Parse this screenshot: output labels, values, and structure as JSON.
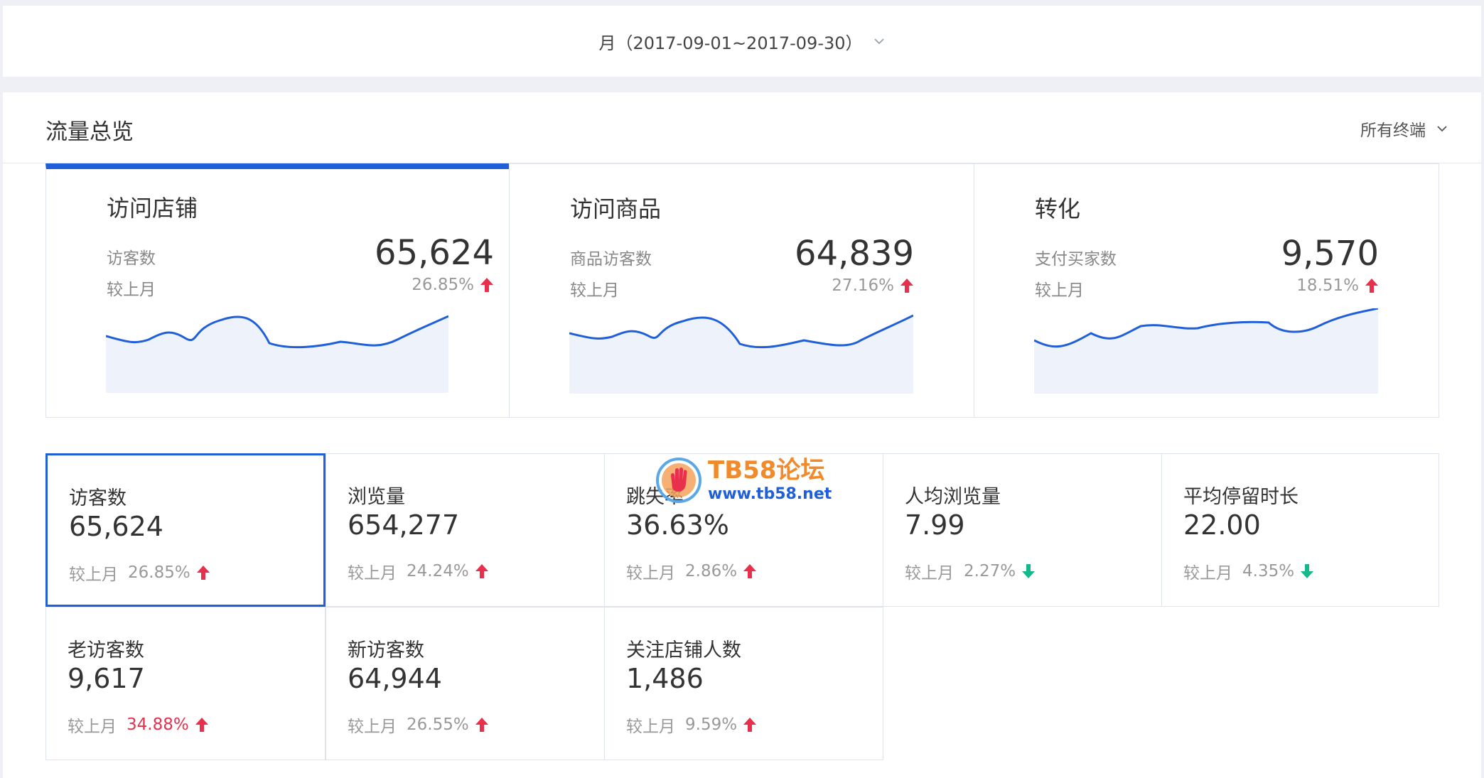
{
  "date_filter": {
    "label": "月（2017-09-01~2017-09-30）"
  },
  "overview": {
    "title": "流量总览",
    "terminal_filter": "所有终端",
    "cards": [
      {
        "title": "访问店铺",
        "metric_label": "访客数",
        "value": "65,624",
        "compare_label": "较上月",
        "change": "26.85%",
        "trend": "up"
      },
      {
        "title": "访问商品",
        "metric_label": "商品访客数",
        "value": "64,839",
        "compare_label": "较上月",
        "change": "27.16%",
        "trend": "up"
      },
      {
        "title": "转化",
        "metric_label": "支付买家数",
        "value": "9,570",
        "compare_label": "较上月",
        "change": "18.51%",
        "trend": "up"
      }
    ]
  },
  "metrics": [
    {
      "label": "访客数",
      "value": "65,624",
      "compare_label": "较上月",
      "change": "26.85%",
      "trend": "up"
    },
    {
      "label": "浏览量",
      "value": "654,277",
      "compare_label": "较上月",
      "change": "24.24%",
      "trend": "up"
    },
    {
      "label": "跳失率",
      "value": "36.63%",
      "compare_label": "较上月",
      "change": "2.86%",
      "trend": "up"
    },
    {
      "label": "人均浏览量",
      "value": "7.99",
      "compare_label": "较上月",
      "change": "2.27%",
      "trend": "down"
    },
    {
      "label": "平均停留时长",
      "value": "22.00",
      "compare_label": "较上月",
      "change": "4.35%",
      "trend": "down"
    },
    {
      "label": "老访客数",
      "value": "9,617",
      "compare_label": "较上月",
      "change": "34.88%",
      "trend": "up"
    },
    {
      "label": "新访客数",
      "value": "64,944",
      "compare_label": "较上月",
      "change": "26.55%",
      "trend": "up"
    },
    {
      "label": "关注店铺人数",
      "value": "1,486",
      "compare_label": "较上月",
      "change": "9.59%",
      "trend": "up"
    }
  ],
  "watermark": {
    "name": "TB58论坛",
    "url": "www.tb58.net"
  },
  "colors": {
    "accent": "#1f5fd9",
    "up": "#e8304d",
    "down": "#14b88a",
    "spark_fill": "#eef2fa"
  }
}
